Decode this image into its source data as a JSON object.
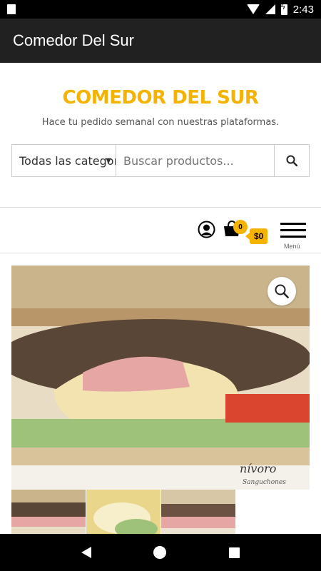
{
  "status_bar": {
    "time": "2:43"
  },
  "app_bar": {
    "title": "Comedor Del Sur"
  },
  "site": {
    "title": "COMEDOR DEL SUR",
    "tagline": "Hace tu pedido semanal con nuestras plataformas."
  },
  "search": {
    "category_selected": "Todas las categorías",
    "placeholder": "Buscar productos..."
  },
  "header_tools": {
    "cart_count": "0",
    "cart_total": "$0",
    "menu_label": "Menú"
  },
  "product": {
    "image_caption": "nívoro",
    "image_subcaption": "Sanguchones"
  },
  "colors": {
    "accent": "#f5b301",
    "appbar": "#212121"
  }
}
